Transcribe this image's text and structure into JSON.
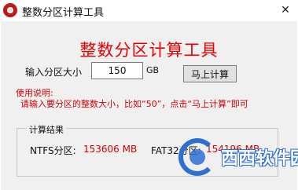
{
  "window": {
    "title": "整数分区计算工具",
    "close_glyph": "✕"
  },
  "main": {
    "heading": "整数分区计算工具",
    "input_label": "输入分区大小",
    "size_value": "150",
    "unit": "GB",
    "calc_button": "马上计算",
    "usage_title": "使用说明:",
    "usage_text": "请输入要分区的整数大小，比如“50”，点击“马上计算”即可"
  },
  "results": {
    "legend": "计算结果",
    "ntfs_label": "NTFS分区:",
    "ntfs_value": "153606 MB",
    "fat32_label": "FAT32分区:",
    "fat32_value": "154196 MB"
  },
  "watermark": {
    "text": "西西软件园"
  },
  "colors": {
    "accent_red": "#e60000",
    "value_red": "#d40000",
    "watermark_blue": "#2f6fd2"
  }
}
